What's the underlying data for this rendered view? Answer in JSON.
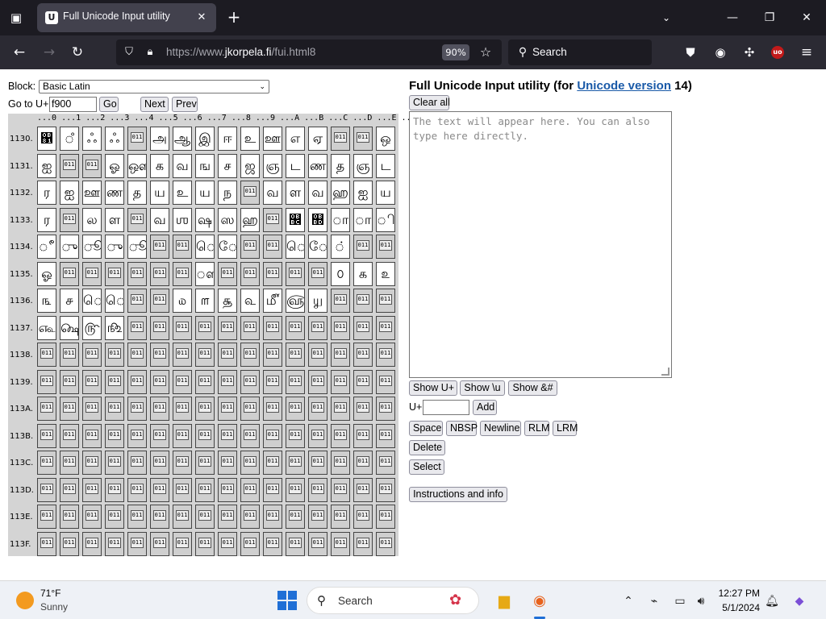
{
  "browser": {
    "tab_title": "Full Unicode Input utility",
    "url_prefix": "https://www.",
    "url_domain": "jkorpela.fi",
    "url_path": "/fui.html8",
    "zoom": "90%",
    "search_placeholder": "Search",
    "icons": {
      "tab_list": "tab-list-icon",
      "tab_close": "close-icon",
      "new_tab": "plus-icon",
      "back": "back-arrow-icon",
      "forward": "forward-arrow-icon",
      "reload": "reload-icon",
      "shield": "shield-icon",
      "lock": "lock-icon",
      "bookmark": "star-icon",
      "pocket": "pocket-icon",
      "account": "account-icon",
      "extensions": "extensions-icon",
      "ublock": "ublock-icon",
      "menu": "hamburger-menu-icon"
    },
    "ublock_label": "uo"
  },
  "page": {
    "block_label": "Block:",
    "block_selected": "Basic Latin",
    "goto_label": "Go to U+",
    "goto_value": "f900",
    "go_button": "Go",
    "next_button": "Next",
    "prev_button": "Prev",
    "heading_prefix": "Full Unicode Input utility (for ",
    "heading_link": "Unicode version",
    "heading_suffix": " 14)",
    "clear_all": "Clear all",
    "textarea_placeholder": "The text will appear here. You can also type here directly.",
    "show_u": "Show U+",
    "show_backslash_u": "Show \\u",
    "show_entity": "Show &#",
    "uplus_label": "U+",
    "add_button": "Add",
    "space": "Space",
    "nbsp": "NBSP",
    "newline": "Newline",
    "rlm": "RLM",
    "lrm": "LRM",
    "delete": "Delete",
    "select": "Select",
    "instructions": "Instructions and info"
  },
  "grid": {
    "column_header": "...0 ...1 ...2 ...3 ...4 ...5 ...6 ...7 ...8 ...9 ...A ...B ...C ...D ...E ...F",
    "rows": [
      {
        "label": "1130.",
        "cells": [
          "஁",
          "ஂ",
          "ஃ",
          "ஃ",
          "ᚠ",
          "அ",
          "ஆ",
          "இ",
          "ஈ",
          "உ",
          "ஊ",
          "எ",
          "ஏ",
          "ᚠ",
          "ᚠ",
          "ஒ"
        ]
      },
      {
        "label": "1131.",
        "cells": [
          "ஐ",
          "ᚠ",
          "ᚠ",
          "ஓ",
          "ஔ",
          "க",
          "வ",
          "ங",
          "ச",
          "ஜ",
          "ஞ",
          "ட",
          "ண",
          "த",
          "ஞ",
          "ட"
        ]
      },
      {
        "label": "1132.",
        "cells": [
          "ர",
          "ஐ",
          "ஊ",
          "ண",
          "த",
          "ய",
          "உ",
          "ய",
          "ந",
          "ᚠ",
          "வ",
          "ள",
          "வ",
          "ஹ",
          "ஐ",
          "ய"
        ]
      },
      {
        "label": "1133.",
        "cells": [
          "ர",
          "ᚠ",
          "ல",
          "ள",
          "ᚠ",
          "வ",
          "ஶ",
          "ஷ",
          "ஸ",
          "ஹ",
          "ᚠ",
          "஼",
          "஽",
          "ா",
          "ா",
          "ி"
        ]
      },
      {
        "label": "1134.",
        "cells": [
          "ீ",
          "ு",
          "ூ",
          "ு",
          "ூ",
          "ᚠ",
          "ᚠ",
          "ெ",
          "ே",
          "ᚠ",
          "ᚠ",
          "ொ",
          "ோ",
          "்",
          "ᚠ",
          "ᚠ"
        ]
      },
      {
        "label": "1135.",
        "cells": [
          "ஓ",
          "ᚠ",
          "ᚠ",
          "ᚠ",
          "ᚠ",
          "ᚠ",
          "ᚠ",
          "ௗ",
          "ᚠ",
          "ᚠ",
          "ᚠ",
          "ᚠ",
          "ᚠ",
          "௦",
          "௧",
          "௨"
        ]
      },
      {
        "label": "1136.",
        "cells": [
          "௩",
          "௪",
          "ெ",
          "ெ",
          "ᚠ",
          "ᚠ",
          "௰",
          "௱",
          "௲",
          "௳",
          "௴",
          "௵",
          "௶",
          "ᚠ",
          "ᚠ",
          "ᚠ"
        ]
      },
      {
        "label": "1137.",
        "cells": [
          "௷",
          "௸",
          "௹",
          "௺",
          "ᚠ",
          "ᚠ",
          "ᚠ",
          "ᚠ",
          "ᚠ",
          "ᚠ",
          "ᚠ",
          "ᚠ",
          "ᚠ",
          "ᚠ",
          "ᚠ",
          "ᚠ"
        ]
      },
      {
        "label": "1138.",
        "cells": [
          "ᚠ",
          "ᚠ",
          "ᚠ",
          "ᚠ",
          "ᚠ",
          "ᚠ",
          "ᚠ",
          "ᚠ",
          "ᚠ",
          "ᚠ",
          "ᚠ",
          "ᚠ",
          "ᚠ",
          "ᚠ",
          "ᚠ",
          "ᚠ"
        ]
      },
      {
        "label": "1139.",
        "cells": [
          "ᚠ",
          "ᚠ",
          "ᚠ",
          "ᚠ",
          "ᚠ",
          "ᚠ",
          "ᚠ",
          "ᚠ",
          "ᚠ",
          "ᚠ",
          "ᚠ",
          "ᚠ",
          "ᚠ",
          "ᚠ",
          "ᚠ",
          "ᚠ"
        ]
      },
      {
        "label": "113A.",
        "cells": [
          "ᚠ",
          "ᚠ",
          "ᚠ",
          "ᚠ",
          "ᚠ",
          "ᚠ",
          "ᚠ",
          "ᚠ",
          "ᚠ",
          "ᚠ",
          "ᚠ",
          "ᚠ",
          "ᚠ",
          "ᚠ",
          "ᚠ",
          "ᚠ"
        ]
      },
      {
        "label": "113B.",
        "cells": [
          "ᚠ",
          "ᚠ",
          "ᚠ",
          "ᚠ",
          "ᚠ",
          "ᚠ",
          "ᚠ",
          "ᚠ",
          "ᚠ",
          "ᚠ",
          "ᚠ",
          "ᚠ",
          "ᚠ",
          "ᚠ",
          "ᚠ",
          "ᚠ"
        ]
      },
      {
        "label": "113C.",
        "cells": [
          "ᚠ",
          "ᚠ",
          "ᚠ",
          "ᚠ",
          "ᚠ",
          "ᚠ",
          "ᚠ",
          "ᚠ",
          "ᚠ",
          "ᚠ",
          "ᚠ",
          "ᚠ",
          "ᚠ",
          "ᚠ",
          "ᚠ",
          "ᚠ"
        ]
      },
      {
        "label": "113D.",
        "cells": [
          "ᚠ",
          "ᚠ",
          "ᚠ",
          "ᚠ",
          "ᚠ",
          "ᚠ",
          "ᚠ",
          "ᚠ",
          "ᚠ",
          "ᚠ",
          "ᚠ",
          "ᚠ",
          "ᚠ",
          "ᚠ",
          "ᚠ",
          "ᚠ"
        ]
      },
      {
        "label": "113E.",
        "cells": [
          "ᚠ",
          "ᚠ",
          "ᚠ",
          "ᚠ",
          "ᚠ",
          "ᚠ",
          "ᚠ",
          "ᚠ",
          "ᚠ",
          "ᚠ",
          "ᚠ",
          "ᚠ",
          "ᚠ",
          "ᚠ",
          "ᚠ",
          "ᚠ"
        ]
      },
      {
        "label": "113F.",
        "cells": [
          "ᚠ",
          "ᚠ",
          "ᚠ",
          "ᚠ",
          "ᚠ",
          "ᚠ",
          "ᚠ",
          "ᚠ",
          "ᚠ",
          "ᚠ",
          "ᚠ",
          "ᚠ",
          "ᚠ",
          "ᚠ",
          "ᚠ",
          "ᚠ"
        ]
      }
    ],
    "unassigned_marker": "ᚠ",
    "unassigned_glyph": "011"
  },
  "taskbar": {
    "temperature": "71°F",
    "condition": "Sunny",
    "search_placeholder": "Search",
    "time": "12:27 PM",
    "date": "5/1/2024",
    "icons": {
      "weather": "sun-icon",
      "start": "windows-start-icon",
      "search": "search-icon",
      "file_explorer": "folder-icon",
      "firefox": "firefox-icon",
      "chevron": "chevron-up-icon",
      "network": "network-icon",
      "display": "display-icon",
      "volume": "volume-icon",
      "notifications": "bell-icon",
      "copilot": "copilot-icon"
    }
  }
}
